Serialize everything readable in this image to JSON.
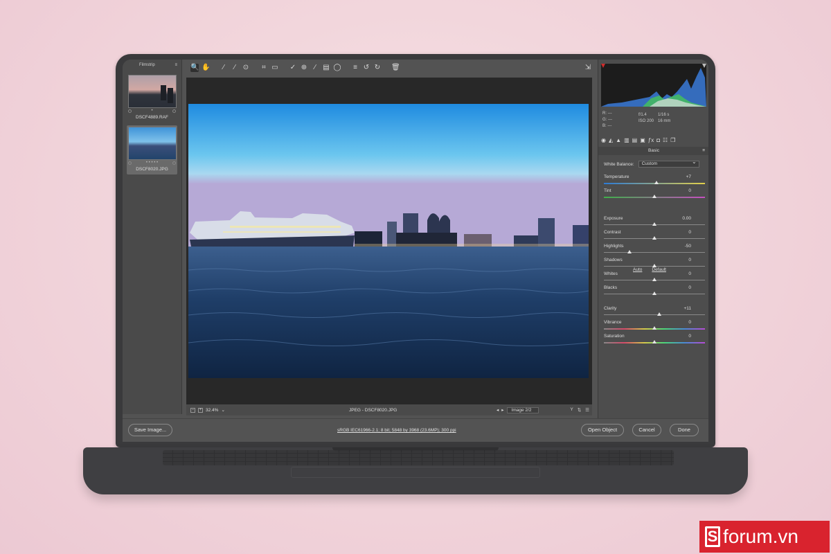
{
  "filmstrip": {
    "title": "Filmstrip",
    "items": [
      {
        "name": "DSCF4889.RAF",
        "rating": "•"
      },
      {
        "name": "DSCF8020.JPG",
        "rating": "• • • • •"
      }
    ]
  },
  "toolbar": {
    "tools": [
      "zoom-icon",
      "hand-icon",
      "white-balance-icon",
      "color-sampler-icon",
      "targeted-adjustment-icon",
      "crop-icon",
      "straighten-icon",
      "spot-removal-icon",
      "red-eye-icon",
      "adjustment-brush-icon",
      "graduated-filter-icon",
      "radial-filter-icon",
      "preferences-icon",
      "rotate-left-icon",
      "rotate-right-icon",
      "trash-icon"
    ],
    "glyphs": [
      "🔍",
      "✋",
      "⁄",
      "⁄",
      "⊙",
      "⌗",
      "▭",
      "✓",
      "⊕",
      "∕",
      "▤",
      "◯",
      "≡",
      "↺",
      "↻",
      "🗑"
    ]
  },
  "status": {
    "zoom": "32.4%",
    "file": "JPEG - DSCF8020.JPG",
    "image_select": "Image 2/2"
  },
  "histogram": {
    "exif": {
      "r": "R: ---",
      "g": "G: ---",
      "b": "B: ---",
      "aperture": "f/1.4",
      "shutter": "1/16 s",
      "iso": "ISO 200",
      "focal": "16 mm"
    }
  },
  "panel": {
    "section": "Basic",
    "white_balance_label": "White Balance:",
    "white_balance_value": "Custom",
    "auto": "Auto",
    "default": "Default",
    "sliders": [
      {
        "label": "Temperature",
        "value": "+7",
        "level": 0.52,
        "kind": "temp"
      },
      {
        "label": "Tint",
        "value": "0",
        "level": 0.5,
        "kind": "tint"
      },
      {
        "label": "Exposure",
        "value": "0.00",
        "level": 0.5,
        "kind": "plain"
      },
      {
        "label": "Contrast",
        "value": "0",
        "level": 0.5,
        "kind": "plain"
      },
      {
        "label": "Highlights",
        "value": "-50",
        "level": 0.25,
        "kind": "plain"
      },
      {
        "label": "Shadows",
        "value": "0",
        "level": 0.5,
        "kind": "plain"
      },
      {
        "label": "Whites",
        "value": "0",
        "level": 0.5,
        "kind": "plain"
      },
      {
        "label": "Blacks",
        "value": "0",
        "level": 0.5,
        "kind": "plain"
      },
      {
        "label": "Clarity",
        "value": "+11",
        "level": 0.55,
        "kind": "plain"
      },
      {
        "label": "Vibrance",
        "value": "0",
        "level": 0.5,
        "kind": "vib"
      },
      {
        "label": "Saturation",
        "value": "0",
        "level": 0.5,
        "kind": "vib"
      }
    ]
  },
  "bottom": {
    "save": "Save Image...",
    "info": "sRGB IEC61966-2.1; 8 bit; 5848 by 3968 (23.6MP); 300 ppi",
    "open": "Open Object",
    "cancel": "Cancel",
    "done": "Done"
  },
  "watermark": "forum.vn"
}
